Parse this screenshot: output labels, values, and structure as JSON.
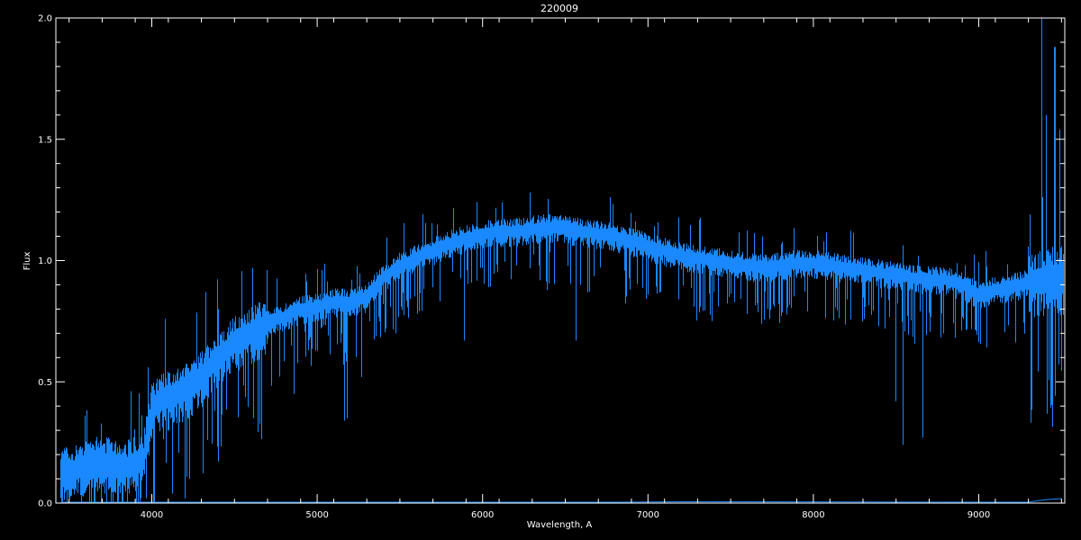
{
  "chart_data": {
    "type": "line",
    "title": "220009",
    "xlabel": "Wavelength, A",
    "ylabel": "Flux",
    "xlim": [
      3420,
      9520
    ],
    "ylim": [
      0.0,
      2.0
    ],
    "x_ticks": [
      4000,
      5000,
      6000,
      7000,
      8000,
      9000
    ],
    "x_tick_labels": [
      "4000",
      "5000",
      "6000",
      "7000",
      "8000",
      "9000"
    ],
    "y_ticks": [
      0.0,
      0.5,
      1.0,
      1.5,
      2.0
    ],
    "y_tick_labels": [
      "0.0",
      "0.5",
      "1.0",
      "1.5",
      "2.0"
    ],
    "grid": false,
    "colors": {
      "background": "#000000",
      "axes": "#ffffff",
      "series": "#1a88ff"
    },
    "series": [
      {
        "continuum": [
          [
            3450,
            0.12
          ],
          [
            3550,
            0.14
          ],
          [
            3650,
            0.17
          ],
          [
            3750,
            0.16
          ],
          [
            3850,
            0.15
          ],
          [
            3950,
            0.18
          ],
          [
            4000,
            0.38
          ],
          [
            4050,
            0.42
          ],
          [
            4100,
            0.44
          ],
          [
            4200,
            0.46
          ],
          [
            4300,
            0.52
          ],
          [
            4400,
            0.6
          ],
          [
            4500,
            0.66
          ],
          [
            4600,
            0.7
          ],
          [
            4700,
            0.74
          ],
          [
            4800,
            0.77
          ],
          [
            4900,
            0.8
          ],
          [
            5000,
            0.81
          ],
          [
            5100,
            0.83
          ],
          [
            5200,
            0.83
          ],
          [
            5300,
            0.85
          ],
          [
            5400,
            0.93
          ],
          [
            5500,
            0.98
          ],
          [
            5600,
            1.01
          ],
          [
            5700,
            1.04
          ],
          [
            5800,
            1.07
          ],
          [
            5900,
            1.09
          ],
          [
            6000,
            1.11
          ],
          [
            6100,
            1.12
          ],
          [
            6200,
            1.12
          ],
          [
            6300,
            1.13
          ],
          [
            6400,
            1.14
          ],
          [
            6500,
            1.13
          ],
          [
            6600,
            1.12
          ],
          [
            6700,
            1.11
          ],
          [
            6800,
            1.1
          ],
          [
            6900,
            1.08
          ],
          [
            7000,
            1.06
          ],
          [
            7100,
            1.04
          ],
          [
            7200,
            1.02
          ],
          [
            7300,
            1.01
          ],
          [
            7400,
            1.0
          ],
          [
            7500,
            0.99
          ],
          [
            7600,
            0.98
          ],
          [
            7700,
            0.97
          ],
          [
            7800,
            0.98
          ],
          [
            7900,
            0.99
          ],
          [
            8000,
            0.99
          ],
          [
            8100,
            0.98
          ],
          [
            8200,
            0.97
          ],
          [
            8300,
            0.96
          ],
          [
            8400,
            0.95
          ],
          [
            8500,
            0.94
          ],
          [
            8600,
            0.93
          ],
          [
            8700,
            0.92
          ],
          [
            8800,
            0.92
          ],
          [
            8900,
            0.9
          ],
          [
            9000,
            0.86
          ],
          [
            9100,
            0.88
          ],
          [
            9200,
            0.89
          ],
          [
            9300,
            0.91
          ],
          [
            9400,
            0.92
          ],
          [
            9500,
            0.93
          ]
        ],
        "features": [
          [
            3934,
            0.02
          ],
          [
            3968,
            0.02
          ],
          [
            4101,
            0.3
          ],
          [
            4227,
            0.1
          ],
          [
            4340,
            0.26
          ],
          [
            4383,
            0.38
          ],
          [
            4861,
            0.45
          ],
          [
            5167,
            0.34
          ],
          [
            5184,
            0.35
          ],
          [
            5270,
            0.52
          ],
          [
            5890,
            0.67
          ],
          [
            6563,
            0.67
          ],
          [
            7600,
            0.78
          ],
          [
            8498,
            0.42
          ],
          [
            8542,
            0.24
          ],
          [
            8662,
            0.27
          ],
          [
            9380,
            2.0
          ],
          [
            9410,
            1.6
          ],
          [
            9460,
            1.88
          ],
          [
            9490,
            1.54
          ],
          [
            9515,
            1.54
          ]
        ],
        "noise_level": 0.05,
        "baseline_trace": [
          [
            3450,
            0.0
          ],
          [
            6800,
            0.0
          ],
          [
            7200,
            0.002
          ],
          [
            9300,
            0.0
          ],
          [
            9400,
            0.01
          ],
          [
            9500,
            0.015
          ]
        ]
      }
    ]
  }
}
